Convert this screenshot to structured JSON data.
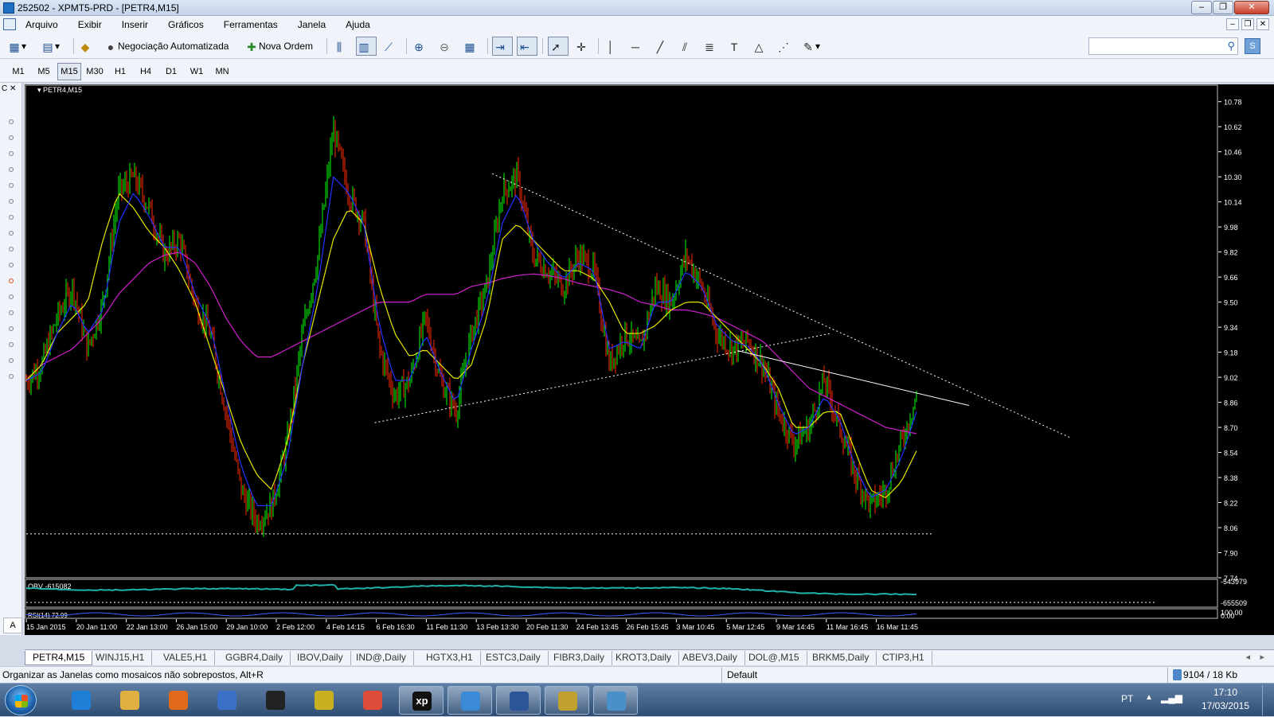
{
  "window": {
    "title": "252502 - XPMT5-PRD - [PETR4,M15]",
    "buttons": {
      "minimize": "–",
      "restore": "❐",
      "close": "✕"
    }
  },
  "menu": {
    "items": [
      "Arquivo",
      "Exibir",
      "Inserir",
      "Gráficos",
      "Ferramentas",
      "Janela",
      "Ajuda"
    ],
    "mdi_controls": [
      "–",
      "❐",
      "✕"
    ]
  },
  "toolbar": {
    "auto_trading_label": "Negociação Automatizada",
    "new_order_label": "Nova Ordem",
    "search_placeholder": ""
  },
  "timeframes": {
    "items": [
      "M1",
      "M5",
      "M15",
      "M30",
      "H1",
      "H4",
      "D1",
      "W1",
      "MN"
    ],
    "active": "M15"
  },
  "navigator": {
    "header": "C ✕"
  },
  "chart": {
    "symbol_label": "PETR4,M15",
    "oscillator_obv_label": "OBV -615082",
    "oscillator_rsi_label": "RSI(14) 72.99",
    "price_ticks": [
      "10.78",
      "10.62",
      "10.46",
      "10.30",
      "10.14",
      "9.98",
      "9.82",
      "9.66",
      "9.50",
      "9.34",
      "9.18",
      "9.02",
      "8.86",
      "8.70",
      "8.54",
      "8.38",
      "8.22",
      "8.06",
      "7.90",
      "7.74"
    ],
    "obv_ticks": [
      "-543979",
      "-655509"
    ],
    "rsi_ticks": [
      "100.00",
      "0.00"
    ],
    "time_ticks": [
      "15 Jan 2015",
      "20 Jan 11:00",
      "22 Jan 13:00",
      "26 Jan 15:00",
      "29 Jan 10:00",
      "2 Feb 12:00",
      "4 Feb 14:15",
      "6 Feb 16:30",
      "11 Feb 11:30",
      "13 Feb 13:30",
      "20 Feb 11:30",
      "24 Feb 13:45",
      "26 Feb 15:45",
      "3 Mar 10:45",
      "5 Mar 12:45",
      "9 Mar 14:45",
      "11 Mar 16:45",
      "16 Mar 11:45"
    ],
    "colors": {
      "background": "#000000",
      "bars_up": "#00ff00",
      "bars_down": "#ff2a00",
      "ma_fast": "#2233ff",
      "ma_mid": "#e6e600",
      "ma_slow": "#d020d0",
      "obv_line": "#20b2aa",
      "axis_text": "#ffffff"
    }
  },
  "chart_data": {
    "type": "candlestick",
    "symbol": "PETR4",
    "timeframe": "M15",
    "y_range": [
      7.74,
      10.86
    ],
    "x_categories": [
      "15 Jan 2015",
      "20 Jan 11:00",
      "22 Jan 13:00",
      "26 Jan 15:00",
      "29 Jan 10:00",
      "2 Feb 12:00",
      "4 Feb 14:15",
      "6 Feb 16:30",
      "11 Feb 11:30",
      "13 Feb 13:30",
      "20 Feb 11:30",
      "24 Feb 13:45",
      "26 Feb 15:45",
      "3 Mar 10:45",
      "5 Mar 12:45",
      "9 Mar 14:45",
      "11 Mar 16:45",
      "16 Mar 11:45"
    ],
    "price_path": [
      9.0,
      9.1,
      9.4,
      9.6,
      9.2,
      9.5,
      10.2,
      10.3,
      10.1,
      9.8,
      9.9,
      9.5,
      9.3,
      8.8,
      8.3,
      8.1,
      8.2,
      8.6,
      9.3,
      9.8,
      10.6,
      10.2,
      10.0,
      9.2,
      8.9,
      9.0,
      9.4,
      9.0,
      8.8,
      9.3,
      9.6,
      10.2,
      10.3,
      9.8,
      9.7,
      9.6,
      9.8,
      9.7,
      9.1,
      9.3,
      9.2,
      9.6,
      9.5,
      9.8,
      9.6,
      9.3,
      9.2,
      9.25,
      9.1,
      8.8,
      8.6,
      8.7,
      9.0,
      8.7,
      8.4,
      8.2,
      8.3,
      8.6,
      8.9
    ],
    "ma_fast_path": [
      9.0,
      9.05,
      9.3,
      9.5,
      9.3,
      9.45,
      10.0,
      10.2,
      10.05,
      9.85,
      9.85,
      9.55,
      9.35,
      8.9,
      8.45,
      8.2,
      8.2,
      8.5,
      9.1,
      9.6,
      10.3,
      10.2,
      10.0,
      9.35,
      9.0,
      9.0,
      9.3,
      9.05,
      8.85,
      9.2,
      9.5,
      10.0,
      10.2,
      9.9,
      9.75,
      9.65,
      9.75,
      9.7,
      9.2,
      9.25,
      9.2,
      9.5,
      9.5,
      9.7,
      9.6,
      9.35,
      9.25,
      9.22,
      9.1,
      8.85,
      8.65,
      8.7,
      8.9,
      8.75,
      8.45,
      8.25,
      8.3,
      8.5,
      8.8
    ],
    "ma_mid_path": [
      9.0,
      9.1,
      9.3,
      9.4,
      9.5,
      9.9,
      10.2,
      10.1,
      9.95,
      9.85,
      9.7,
      9.5,
      9.2,
      8.9,
      8.6,
      8.4,
      8.3,
      8.6,
      9.1,
      9.5,
      9.9,
      10.1,
      10.0,
      9.6,
      9.3,
      9.15,
      9.2,
      9.1,
      9.0,
      9.1,
      9.4,
      9.9,
      10.0,
      9.9,
      9.8,
      9.7,
      9.7,
      9.65,
      9.5,
      9.3,
      9.3,
      9.35,
      9.45,
      9.5,
      9.5,
      9.4,
      9.3,
      9.2,
      9.1,
      8.95,
      8.7,
      8.7,
      8.8,
      8.8,
      8.55,
      8.3,
      8.25,
      8.35,
      8.55
    ],
    "ma_slow_path": [
      9.0,
      9.1,
      9.15,
      9.2,
      9.3,
      9.4,
      9.55,
      9.65,
      9.75,
      9.8,
      9.82,
      9.75,
      9.6,
      9.4,
      9.25,
      9.15,
      9.15,
      9.2,
      9.25,
      9.3,
      9.35,
      9.4,
      9.45,
      9.5,
      9.5,
      9.5,
      9.55,
      9.55,
      9.55,
      9.6,
      9.62,
      9.65,
      9.67,
      9.68,
      9.67,
      9.65,
      9.62,
      9.6,
      9.58,
      9.55,
      9.5,
      9.48,
      9.45,
      9.45,
      9.43,
      9.4,
      9.35,
      9.3,
      9.25,
      9.15,
      9.05,
      8.95,
      8.9,
      8.85,
      8.8,
      8.75,
      8.7,
      8.68,
      8.66
    ],
    "trendlines": [
      {
        "name": "resistance",
        "style": "dotted",
        "from": [
          "13 Feb 13:30",
          10.32
        ],
        "to": [
          "16 Mar 11:45+",
          8.63
        ]
      },
      {
        "name": "support",
        "style": "dotted",
        "from": [
          "6 Feb 16:30",
          8.73
        ],
        "to": [
          "5 Mar 12:45+",
          9.3
        ]
      },
      {
        "name": "neckline",
        "style": "solid",
        "from": [
          "5 Mar 12:45",
          9.19
        ],
        "to": [
          "16 Mar 11:45+",
          8.84
        ]
      },
      {
        "name": "horizontal",
        "style": "dotted",
        "from": [
          "15 Jan 2015",
          8.02
        ],
        "to": [
          "16 Mar 11:45+",
          8.02
        ]
      }
    ]
  },
  "symbol_tabs": {
    "items": [
      "PETR4,M15",
      "WINJ15,H1",
      "VALE5,H1",
      "GGBR4,Daily",
      "IBOV,Daily",
      "IND@,Daily",
      "HGTX3,H1",
      "ESTC3,Daily",
      "FIBR3,Daily",
      "KROT3,Daily",
      "ABEV3,Daily",
      "DOL@,M15",
      "BRKM5,Daily",
      "CTIP3,H1"
    ],
    "active": "PETR4,M15",
    "scroll_left": "◂",
    "scroll_right": "▸"
  },
  "status": {
    "hint": "Organizar as Janelas como mosaicos não sobrepostos, Alt+R",
    "profile": "Default",
    "connection": "9104 / 18 Kb"
  },
  "taskbar": {
    "apps": [
      "ie-icon",
      "explorer-icon",
      "media-player-icon",
      "remote-icon",
      "hp-icon",
      "stack-icon",
      "chrome-icon",
      "xp-icon",
      "metatrader-icon",
      "word-icon",
      "paint-icon",
      "photo-viewer-icon"
    ],
    "xp_label": "xp",
    "lang": "PT",
    "time": "17:10",
    "date": "17/03/2015"
  },
  "corner": {
    "a_label": "A"
  }
}
